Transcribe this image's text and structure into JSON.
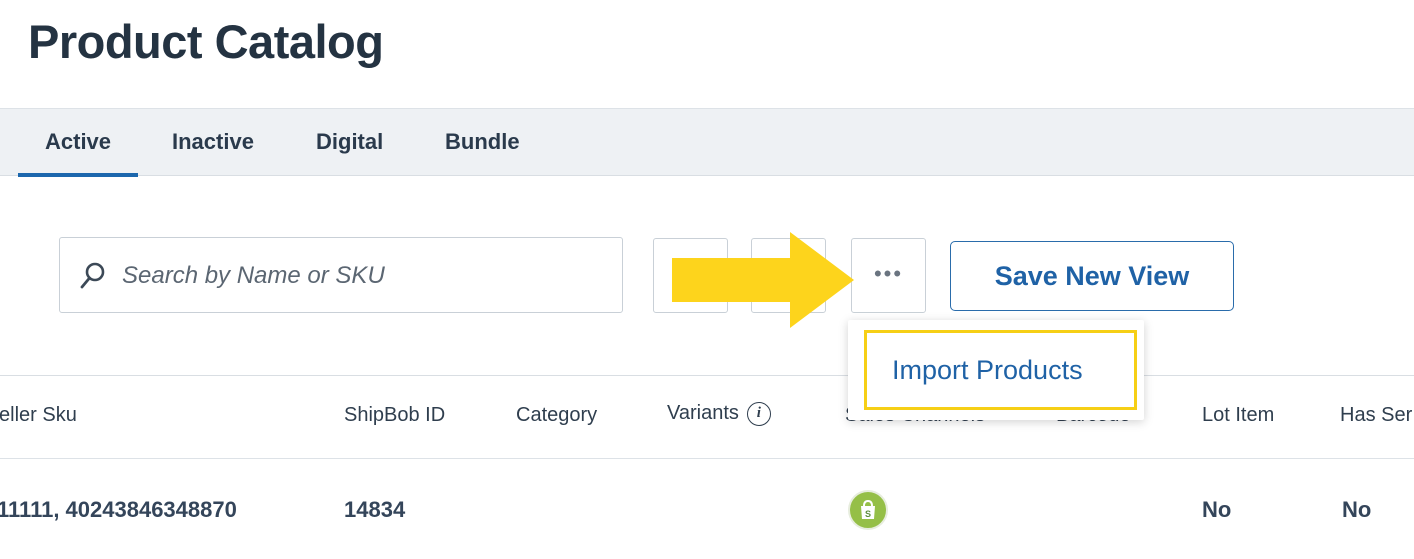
{
  "page": {
    "title": "Product Catalog"
  },
  "tabs": [
    {
      "label": "Active",
      "active": true
    },
    {
      "label": "Inactive",
      "active": false
    },
    {
      "label": "Digital",
      "active": false
    },
    {
      "label": "Bundle",
      "active": false
    }
  ],
  "toolbar": {
    "search_placeholder": "Search by Name or SKU",
    "more_icon": "more-horizontal-icon",
    "save_view_label": "Save New View"
  },
  "dropdown": {
    "items": [
      "Import Products"
    ]
  },
  "table": {
    "columns": [
      "eller Sku",
      "ShipBob ID",
      "Category",
      "Variants",
      "Sales Channels",
      "Barcode",
      "Lot Item",
      "Has Ser"
    ],
    "rows": [
      {
        "seller_sku": "11111, 40243846348870",
        "shipbob_id": "14834",
        "category": "",
        "variants": "",
        "sales_channel_icon": "shopify-icon",
        "barcode": "",
        "lot_item": "No",
        "has_serial": "No"
      }
    ]
  },
  "colors": {
    "accent": "#1f62a6",
    "highlight": "#fdd41c",
    "tabbar_bg": "#eef1f4",
    "shopify_green": "#95bf47"
  }
}
